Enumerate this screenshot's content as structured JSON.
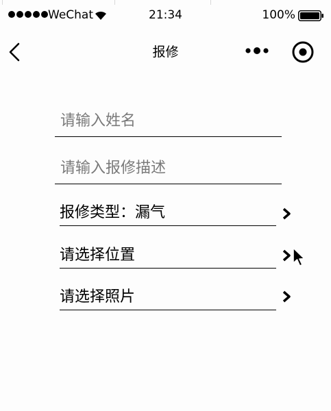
{
  "status_bar": {
    "carrier": "WeChat",
    "time": "21:34",
    "battery": "100%",
    "icons": [
      "signal-dots-icon",
      "wifi-icon",
      "battery-icon"
    ]
  },
  "nav": {
    "title": "报修",
    "icons": [
      "back-arrow-icon",
      "more-dots-icon",
      "target-icon"
    ]
  },
  "form": {
    "name_placeholder": "请输入姓名",
    "name_value": "",
    "desc_placeholder": "请输入报修描述",
    "desc_value": "",
    "repair_type": "报修类型：漏气",
    "location": "请选择位置",
    "photo": "请选择照片"
  }
}
